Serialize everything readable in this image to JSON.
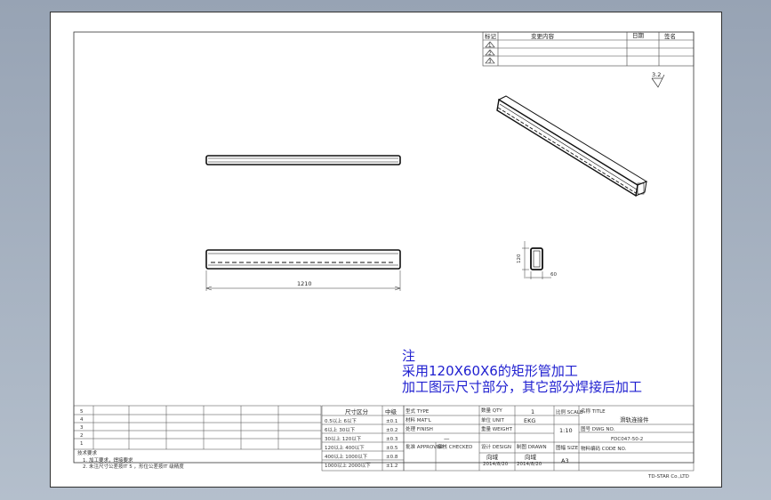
{
  "revision_table": {
    "headers": [
      "标记",
      "变更内容",
      "日期",
      "签名"
    ],
    "marks": [
      "1",
      "2",
      "3"
    ]
  },
  "roughness": "3.2",
  "dimensions": {
    "length": "1210",
    "section_height": "120",
    "section_width": "60"
  },
  "note": {
    "title": "注",
    "line1": "采用120X60X6的矩形管加工",
    "line2": "加工图示尺寸部分，其它部分焊接后加工"
  },
  "tech_requirements": {
    "title": "技术要求",
    "line1": "1.  加工要求，焊接要求",
    "line2": "2.  未注尺寸公差按IT 5 ，形位公差按IT 级精度"
  },
  "tolerance_table": {
    "headers": [
      "尺寸区分",
      "中级"
    ],
    "rows": [
      [
        "0.5以上  6以下",
        "±0.1"
      ],
      [
        "6以上  30以下",
        "±0.2"
      ],
      [
        "30以上  120以下",
        "±0.3"
      ],
      [
        "120以上  400以下",
        "±0.5"
      ],
      [
        "400以上  1000以下",
        "±0.8"
      ],
      [
        "1000以上  2000以下",
        "±1.2"
      ]
    ]
  },
  "title_block": {
    "type_label": "型式 TYPE",
    "material_label": "材料 MAT'L",
    "treatment_label": "处理 FINISH",
    "treatment_value": "—",
    "qty_label": "数量 QTY",
    "qty_value": "1",
    "unit_label": "单位 UNIT",
    "unit_value": "EKG",
    "weight_label": "重量 WEIGHT",
    "scale_label": "比例 SCALE",
    "scale_value": "1:10",
    "name_label": "名称 TITLE",
    "name_value": "滑轨连接件",
    "dwg_label": "图号 DWG NO.",
    "dwg_value": "FDC047-50-2",
    "code_label": "物料编码 CODE NO.",
    "approved_label": "批准 APPROVED",
    "checked_label": "审核 CHECKED",
    "design_label": "设计 DESIGN",
    "design_name": "向域",
    "design_date": "2014/8/20",
    "drawn_label": "制图 DRAWN",
    "drawn_name": "向域",
    "drawn_date": "2014/8/20",
    "size_label": "图幅 SIZE",
    "size_value": "A3",
    "marks": [
      "5",
      "4",
      "3",
      "2",
      "1"
    ]
  },
  "company": "TD-STAR Co.,LTD"
}
